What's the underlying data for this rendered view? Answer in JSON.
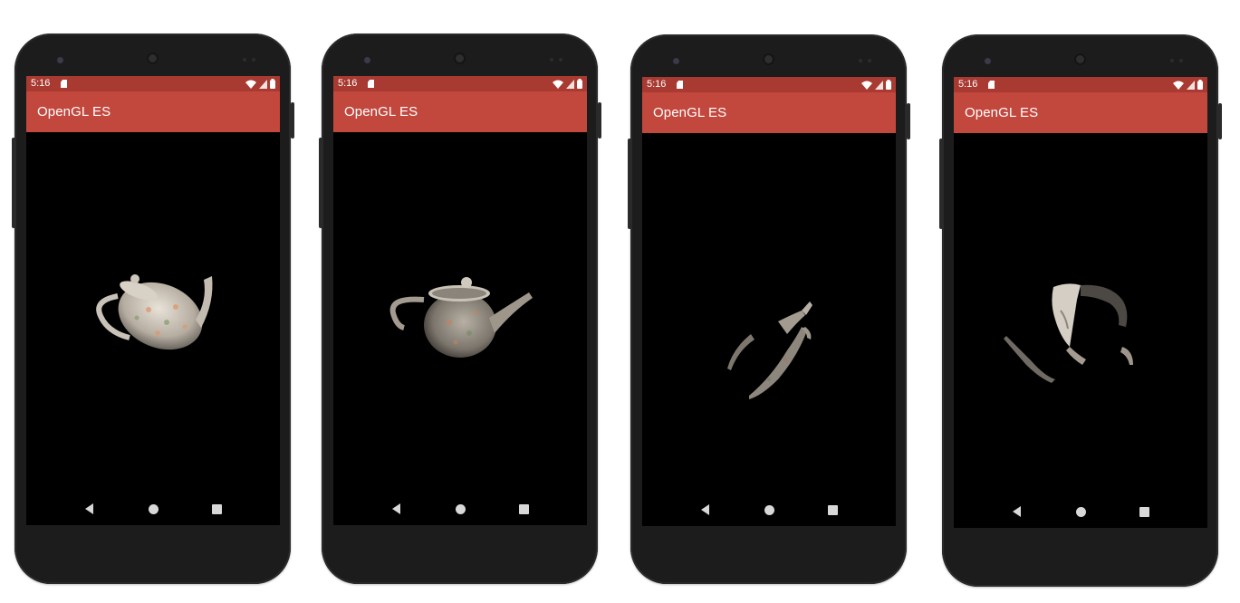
{
  "phones": [
    {
      "status": {
        "time": "5:16"
      },
      "app_bar": {
        "title": "OpenGL ES"
      }
    },
    {
      "status": {
        "time": "5:16"
      },
      "app_bar": {
        "title": "OpenGL ES"
      }
    },
    {
      "status": {
        "time": "5:16"
      },
      "app_bar": {
        "title": "OpenGL ES"
      }
    },
    {
      "status": {
        "time": "5:16"
      },
      "app_bar": {
        "title": "OpenGL ES"
      }
    }
  ],
  "colors": {
    "status_bar": "#a83a31",
    "app_bar": "#c2483e",
    "screen_bg": "#000000",
    "phone_body": "#1c1c1c"
  },
  "icons": {
    "status": [
      "sd-card-icon",
      "wifi-icon",
      "signal-icon",
      "battery-icon"
    ],
    "navigation": [
      "back-icon",
      "home-icon",
      "recents-icon"
    ]
  }
}
